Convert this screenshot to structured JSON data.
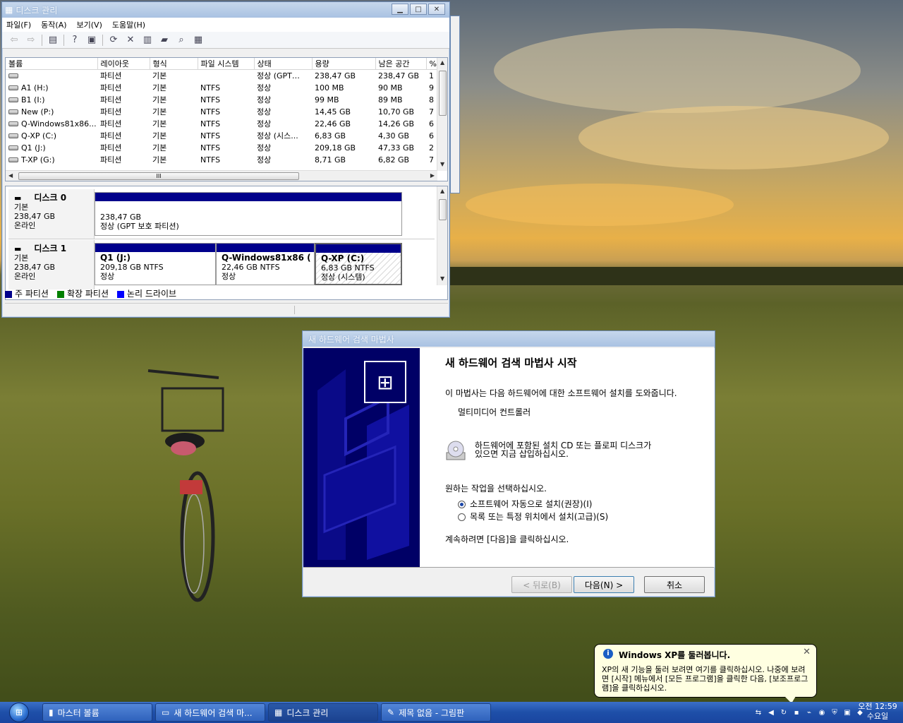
{
  "diskmgmt": {
    "title": "디스크 관리",
    "menus": [
      "파일(F)",
      "동작(A)",
      "보기(V)",
      "도움말(H)"
    ],
    "columns": [
      "볼륨",
      "레이아웃",
      "형식",
      "파일 시스템",
      "상태",
      "용량",
      "남은 공간",
      "%"
    ],
    "rows": [
      [
        "",
        "파티션",
        "기본",
        "",
        "정상 (GPT…",
        "238,47 GB",
        "238,47 GB",
        "1"
      ],
      [
        "A1 (H:)",
        "파티션",
        "기본",
        "NTFS",
        "정상",
        "100 MB",
        "90 MB",
        "9"
      ],
      [
        "B1 (I:)",
        "파티션",
        "기본",
        "NTFS",
        "정상",
        "99 MB",
        "89 MB",
        "8"
      ],
      [
        "New (P:)",
        "파티션",
        "기본",
        "NTFS",
        "정상",
        "14,45 GB",
        "10,70 GB",
        "7"
      ],
      [
        "Q-Windows81x86...",
        "파티션",
        "기본",
        "NTFS",
        "정상",
        "22,46 GB",
        "14,26 GB",
        "6"
      ],
      [
        "Q-XP (C:)",
        "파티션",
        "기본",
        "NTFS",
        "정상 (시스...",
        "6,83 GB",
        "4,30 GB",
        "6"
      ],
      [
        "Q1 (J:)",
        "파티션",
        "기본",
        "NTFS",
        "정상",
        "209,18 GB",
        "47,33 GB",
        "2"
      ],
      [
        "T-XP (G:)",
        "파티션",
        "기본",
        "NTFS",
        "정상",
        "8,71 GB",
        "6,82 GB",
        "7"
      ]
    ],
    "hscroll_grip": "III",
    "disk0": {
      "name": "디스크 0",
      "type": "기본",
      "size": "238,47 GB",
      "state": "온라인",
      "part_size": "238,47 GB",
      "part_status": "정상 (GPT 보호 파티션)"
    },
    "disk1": {
      "name": "디스크 1",
      "type": "기본",
      "size": "238,47 GB",
      "state": "온라인",
      "parts": [
        {
          "name": "Q1  (J:)",
          "size": "209,18 GB NTFS",
          "status": "정상"
        },
        {
          "name": "Q-Windows81x86  (",
          "size": "22,46 GB NTFS",
          "status": "정상"
        },
        {
          "name": "Q-XP  (C:)",
          "size": "6,83 GB NTFS",
          "status": "정상 (시스템)"
        }
      ]
    },
    "legend": [
      "주 파티션",
      "확장 파티션",
      "논리 드라이브"
    ],
    "legend_colors": [
      "#00008b",
      "#008000",
      "#0000ff"
    ]
  },
  "wizard": {
    "title": "새 하드웨어 검색 마법사",
    "heading": "새 하드웨어 검색 마법사 시작",
    "intro": "이 마법사는 다음 하드웨어에 대한 소프트웨어 설치를 도와줍니다.",
    "device": "멀티미디어 컨트롤러",
    "cd_text_1": "하드웨어에 포함된 설치 CD 또는 플로피 디스크가",
    "cd_text_2": "있으면 지금 삽입하십시오.",
    "choose": "원하는 작업을 선택하십시오.",
    "option1": "소프트웨어 자동으로 설치(권장)(I)",
    "option2": "목록 또는 특정 위치에서 설치(고급)(S)",
    "continue": "계속하려면 [다음]을 클릭하십시오.",
    "back": "< 뒤로(B)",
    "next": "다음(N) >",
    "cancel": "취소"
  },
  "balloon": {
    "title": "Windows XP를 둘러봅니다.",
    "body": "XP의 새 기능을 둘러 보려면 여기를 클릭하십시오. 나중에 보려면 [시작] 메뉴에서 [모든 프로그램]을 클릭한 다음, [보조프로그램]을 클릭하십시오."
  },
  "taskbar": {
    "items": [
      "마스터 볼륨",
      "새 하드웨어 검색 마...",
      "디스크 관리",
      "제목 없음 - 그림판"
    ],
    "time": "오전 12:59",
    "day": "수요일"
  }
}
